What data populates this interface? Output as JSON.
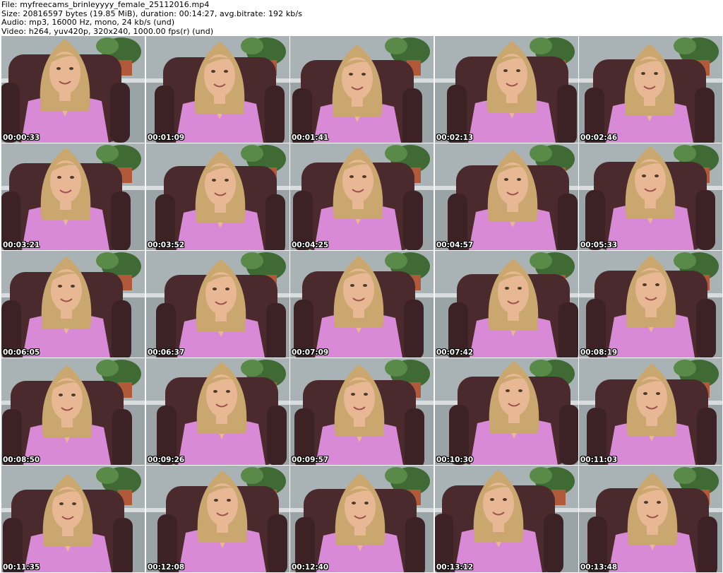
{
  "header": {
    "file_line": "File: myfreecams_brinleyyyy_female_25112016.mp4",
    "size_line": "Size: 20816597 bytes (19.85 MiB), duration: 00:14:27, avg.bitrate: 192 kb/s",
    "audio_line": "Audio: mp3, 16000 Hz, mono, 24 kb/s (und)",
    "video_line": "Video: h264, yuv420p, 320x240, 1000.00 fps(r) (und)"
  },
  "thumbnails": [
    "00:00:33",
    "00:01:09",
    "00:01:41",
    "00:02:13",
    "00:02:46",
    "00:03:21",
    "00:03:52",
    "00:04:25",
    "00:04:57",
    "00:05:33",
    "00:06:05",
    "00:06:37",
    "00:07:09",
    "00:07:42",
    "00:08:19",
    "00:08:50",
    "00:09:26",
    "00:09:57",
    "00:10:30",
    "00:11:03",
    "00:11:35",
    "00:12:08",
    "00:12:40",
    "00:13:12",
    "00:13:48"
  ],
  "colors": {
    "wall": "#a9b3b6",
    "chair": "#4a2a2c",
    "shirt": "#d98ad6",
    "hair": "#c9a76e",
    "skin": "#e8b894",
    "plant": "#3f6a34",
    "pot": "#b05a3a"
  }
}
